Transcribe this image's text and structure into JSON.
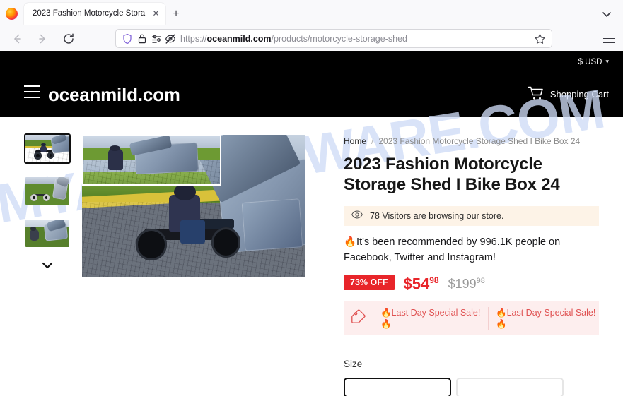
{
  "browser": {
    "tab": {
      "title": "2023 Fashion Motorcycle Stora",
      "close_label": "✕"
    },
    "new_tab_label": "+",
    "url": {
      "scheme": "https://",
      "domain": "oceanmild.com",
      "path": "/products/motorcycle-storage-shed",
      "full": "https://oceanmild.com/products/motorcycle-storage-shed"
    },
    "icons": {
      "back": "back-arrow-icon",
      "forward": "forward-arrow-icon",
      "reload": "reload-icon",
      "shield": "shield-icon",
      "lock": "lock-icon",
      "permissions": "permissions-icon",
      "tracking_blocked": "tracking-protection-off-icon",
      "bookmark": "bookmark-star-icon",
      "app_menu": "hamburger-menu-icon",
      "tab_list": "chevron-down-icon",
      "firefox": "firefox-logo-icon"
    }
  },
  "site": {
    "announcement": {
      "currency": "$ USD",
      "chevron": "⌄"
    },
    "header": {
      "logo": "oceanmild.com",
      "cart_label": "Shopping Cart"
    },
    "watermark": "MYANTISPYWARE.COM"
  },
  "product": {
    "breadcrumb": {
      "home": "Home",
      "separator": "/",
      "current": "2023 Fashion Motorcycle Storage Shed I Bike Box 24"
    },
    "title": "2023 Fashion Motorcycle Storage Shed I Bike Box 24",
    "visitors_text": "78 Visitors are browsing our store.",
    "visitors_count": 78,
    "recommend_text": "🔥It's been recommended by 996.1K people on Facebook, Twitter and Instagram!",
    "recommend_count": "996.1K",
    "price": {
      "discount_badge": "73% OFF",
      "discount_percent": 73,
      "sale_dollars": "$54",
      "sale_cents": "98",
      "compare_dollars": "$199",
      "compare_cents": "98"
    },
    "sale_banner": {
      "items": [
        "🔥Last Day Special Sale!🔥",
        "🔥Last Day Special Sale!🔥"
      ]
    },
    "size": {
      "label": "Size",
      "options": [
        {
          "label": "",
          "selected": true
        },
        {
          "label": "",
          "selected": false
        }
      ]
    },
    "gallery": {
      "next_chevron": "⌄",
      "thumbnails": [
        {
          "alt": "motorcycle-entering-storage-pod",
          "selected": true
        },
        {
          "alt": "motorcycle-parked-beside-open-pod",
          "selected": false
        },
        {
          "alt": "person-opening-storage-pod-lid",
          "selected": false
        }
      ]
    },
    "colors": {
      "accent_red": "#e8252a",
      "banner_peach": "#fdf3e7",
      "banner_pink": "#fdeeee",
      "header_black": "#000000",
      "watermark_blue": "#cfdcf7"
    }
  }
}
